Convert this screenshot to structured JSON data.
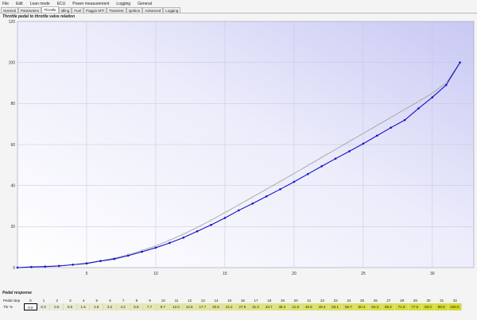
{
  "menu": [
    "File",
    "Edit",
    "Lean mode",
    "ECU",
    "Power measurement",
    "Logging",
    "General"
  ],
  "tabs": [
    "General",
    "Parameters",
    "Throttle",
    "Idling",
    "Fuel",
    "Paggio MTI",
    "Transient",
    "Ignition",
    "Advanced",
    "Logging"
  ],
  "active_tab": 2,
  "chart_title": "Throttle pedal to throttle valve relation",
  "chart_data": {
    "type": "line",
    "title": "Throttle pedal to throttle valve relation",
    "xlabel": "",
    "ylabel": "",
    "xlim": [
      0,
      33
    ],
    "ylim": [
      0,
      120
    ],
    "x_ticks": [
      5,
      10,
      15,
      20,
      25,
      30
    ],
    "y_ticks": [
      0,
      20,
      40,
      60,
      80,
      100,
      120
    ],
    "grid": true,
    "x": [
      0,
      1,
      2,
      3,
      4,
      5,
      6,
      7,
      8,
      9,
      10,
      11,
      12,
      13,
      14,
      15,
      16,
      17,
      18,
      19,
      20,
      21,
      22,
      23,
      24,
      25,
      26,
      27,
      28,
      29,
      30,
      31,
      32
    ],
    "series": [
      {
        "color": "#9a9a9a",
        "values": [
          0,
          0.2,
          0.4,
          0.8,
          1.4,
          2.2,
          3.3,
          4.6,
          6.3,
          8.3,
          10.6,
          13.3,
          16.3,
          19.6,
          23.1,
          26.8,
          30.6,
          34.4,
          38.2,
          42.0,
          45.9,
          49.8,
          53.7,
          57.6,
          61.5,
          65.4,
          69.3,
          73.2,
          77.1,
          81.0,
          85.0,
          90.0,
          100.0
        ]
      },
      {
        "color": "#1010c8",
        "values": [
          0,
          0.3,
          0.5,
          0.8,
          1.4,
          2.0,
          3.2,
          4.2,
          5.8,
          7.7,
          9.7,
          12.0,
          14.6,
          17.7,
          20.8,
          24.2,
          27.9,
          31.2,
          34.7,
          38.2,
          41.8,
          45.6,
          49.4,
          53.1,
          56.7,
          60.4,
          64.3,
          68.2,
          71.9,
          77.6,
          83.0,
          89.0,
          100.0
        ]
      }
    ]
  },
  "pedal_response": {
    "title": "Pedal response",
    "row_header_label": "Pedal step",
    "row_value_label": "Thr %",
    "steps": [
      "0",
      "1",
      "2",
      "3",
      "4",
      "5",
      "6",
      "7",
      "8",
      "9",
      "10",
      "11",
      "12",
      "13",
      "14",
      "15",
      "16",
      "17",
      "18",
      "19",
      "20",
      "21",
      "22",
      "23",
      "24",
      "25",
      "26",
      "27",
      "28",
      "29",
      "30",
      "31",
      "32"
    ],
    "values": [
      "0.0",
      "0.3",
      "0.5",
      "0.8",
      "1.6",
      "2.8",
      "3.2",
      "4.2",
      "5.8",
      "7.7",
      "9.7",
      "12.0",
      "14.6",
      "17.7",
      "20.6",
      "24.2",
      "27.9",
      "31.2",
      "34.7",
      "38.2",
      "41.8",
      "45.6",
      "49.4",
      "53.1",
      "56.7",
      "60.4",
      "64.3",
      "68.2",
      "71.9",
      "77.6",
      "83.0",
      "89.0",
      "100.0"
    ],
    "selected_index": 0
  }
}
